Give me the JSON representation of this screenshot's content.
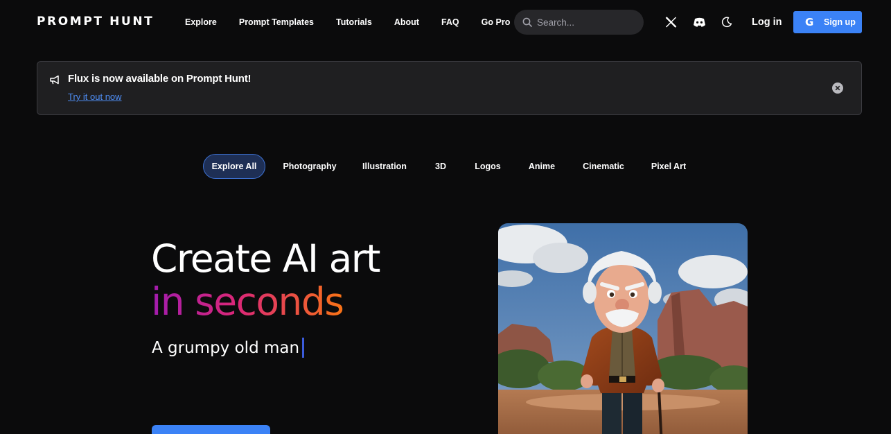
{
  "header": {
    "logo": "PROMPT HUNT",
    "nav": [
      "Explore",
      "Prompt Templates",
      "Tutorials",
      "About",
      "FAQ",
      "Go Pro"
    ],
    "search_placeholder": "Search...",
    "login_label": "Log in",
    "signup_label": "Sign up",
    "signup_icon": "G"
  },
  "announcement": {
    "title": "Flux is now available on Prompt Hunt!",
    "link": "Try it out now"
  },
  "categories": {
    "items": [
      "Explore All",
      "Photography",
      "Illustration",
      "3D",
      "Logos",
      "Anime",
      "Cinematic",
      "Pixel Art"
    ],
    "active": "Explore All"
  },
  "hero": {
    "line1": "Create AI art",
    "line2": "in seconds",
    "typed_prompt": "A grumpy old man"
  },
  "colors": {
    "accent": "#3b82f6",
    "background": "#0b0b0c",
    "announcement_bg": "#1f1f21",
    "pill_active_bg": "#1e2f55",
    "gradient": [
      "#a21caf",
      "#db2777",
      "#f97316"
    ]
  }
}
